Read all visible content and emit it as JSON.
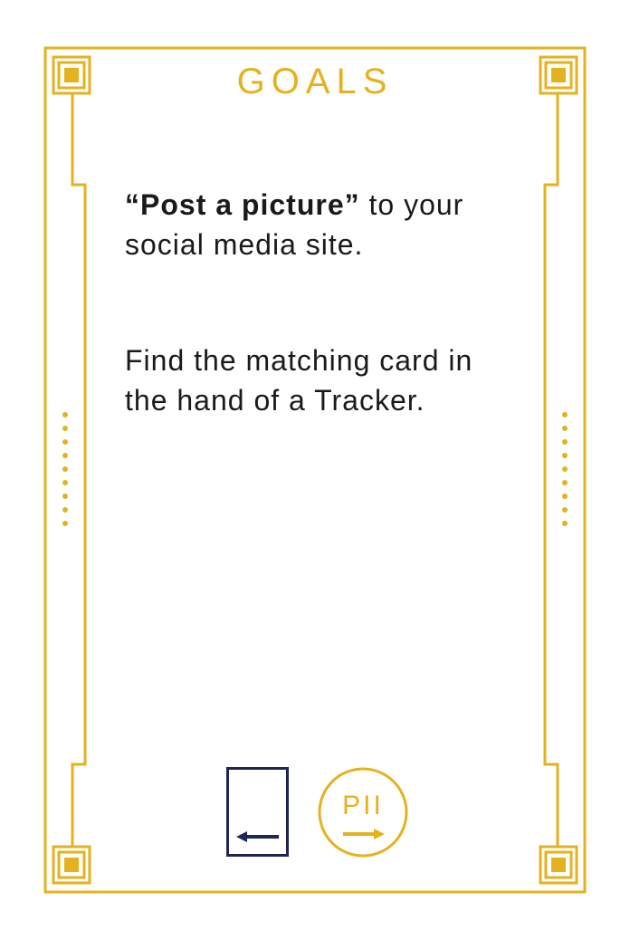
{
  "card": {
    "title": "GOALS",
    "goal_bold": "“Post a picture”",
    "goal_rest": " to your social media site.",
    "instruction": "Find the matching card in the hand of a Tracker.",
    "badge_label": "PII"
  },
  "colors": {
    "frame": "#e5b21f",
    "text": "#1a1a1a",
    "card_icon": "#1f2557"
  },
  "icons": {
    "left_icon": "card-arrow-left-icon",
    "right_icon": "pii-arrow-right-icon"
  }
}
